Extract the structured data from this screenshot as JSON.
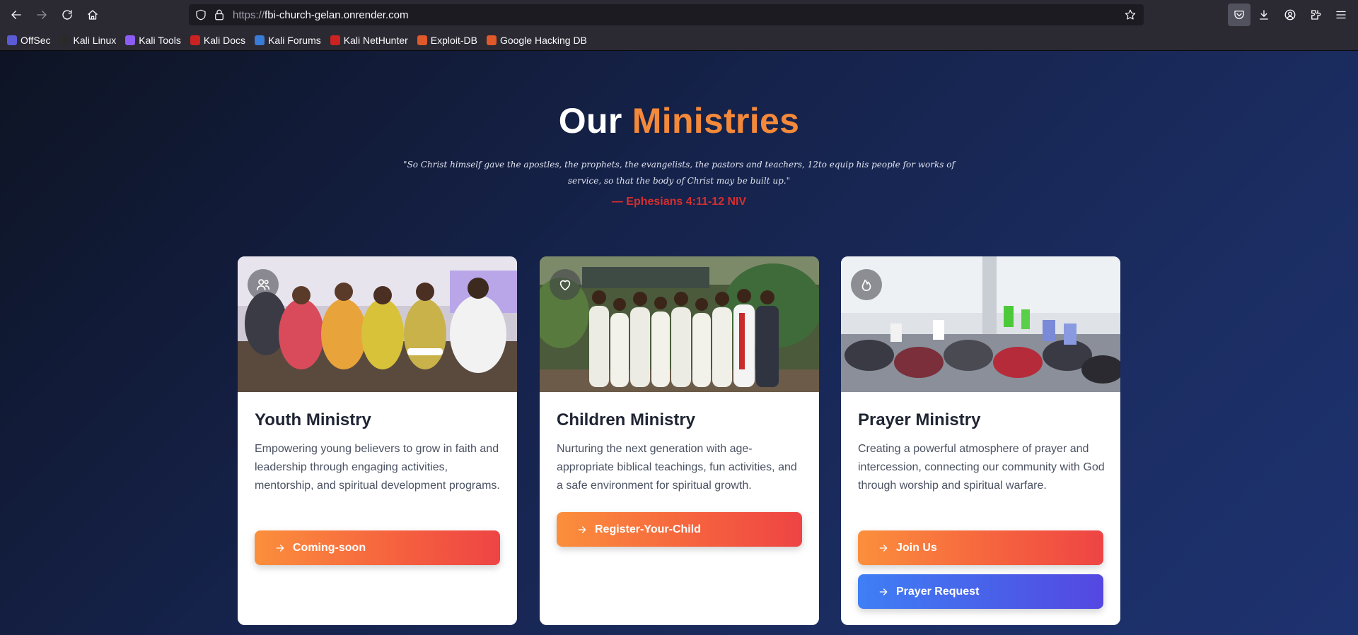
{
  "browser": {
    "url_prefix": "https://",
    "url_domain": "fbi-church-gelan.onrender.com",
    "bookmarks": [
      {
        "label": "OffSec",
        "color": "#5b5bd6"
      },
      {
        "label": "Kali Linux",
        "color": "#2a2a2a"
      },
      {
        "label": "Kali Tools",
        "color": "#8b5cf6"
      },
      {
        "label": "Kali Docs",
        "color": "#cc2222"
      },
      {
        "label": "Kali Forums",
        "color": "#3a7bd5"
      },
      {
        "label": "Kali NetHunter",
        "color": "#cc2222"
      },
      {
        "label": "Exploit-DB",
        "color": "#e0592a"
      },
      {
        "label": "Google Hacking DB",
        "color": "#e0592a"
      }
    ]
  },
  "section": {
    "title_white": "Our",
    "title_accent": "Ministries",
    "quote": "\"So Christ himself gave the apostles, the prophets, the evangelists, the pastors and teachers, 12to equip his people for works of service, so that the body of Christ may be built up.\"",
    "reference": "— Ephesians 4:11-12 NIV"
  },
  "cards": [
    {
      "icon": "users-icon",
      "title": "Youth Ministry",
      "description": "Empowering young believers to grow in faith and leadership through engaging activities, mentorship, and spiritual development programs.",
      "buttons": [
        {
          "label": "Coming-soon",
          "style": "orange"
        }
      ]
    },
    {
      "icon": "heart-icon",
      "title": "Children Ministry",
      "description": "Nurturing the next generation with age-appropriate biblical teachings, fun activities, and a safe environment for spiritual growth.",
      "buttons": [
        {
          "label": "Register-Your-Child",
          "style": "orange"
        }
      ]
    },
    {
      "icon": "flame-icon",
      "title": "Prayer Ministry",
      "description": "Creating a powerful atmosphere of prayer and intercession, connecting our community with God through worship and spiritual warfare.",
      "buttons": [
        {
          "label": "Join Us",
          "style": "orange"
        },
        {
          "label": "Prayer Request",
          "style": "blue"
        }
      ]
    }
  ],
  "colors": {
    "accent": "#f4893a",
    "reference": "#d32f2f",
    "button_orange": "#f5603f",
    "button_blue": "#4a5ee8"
  }
}
